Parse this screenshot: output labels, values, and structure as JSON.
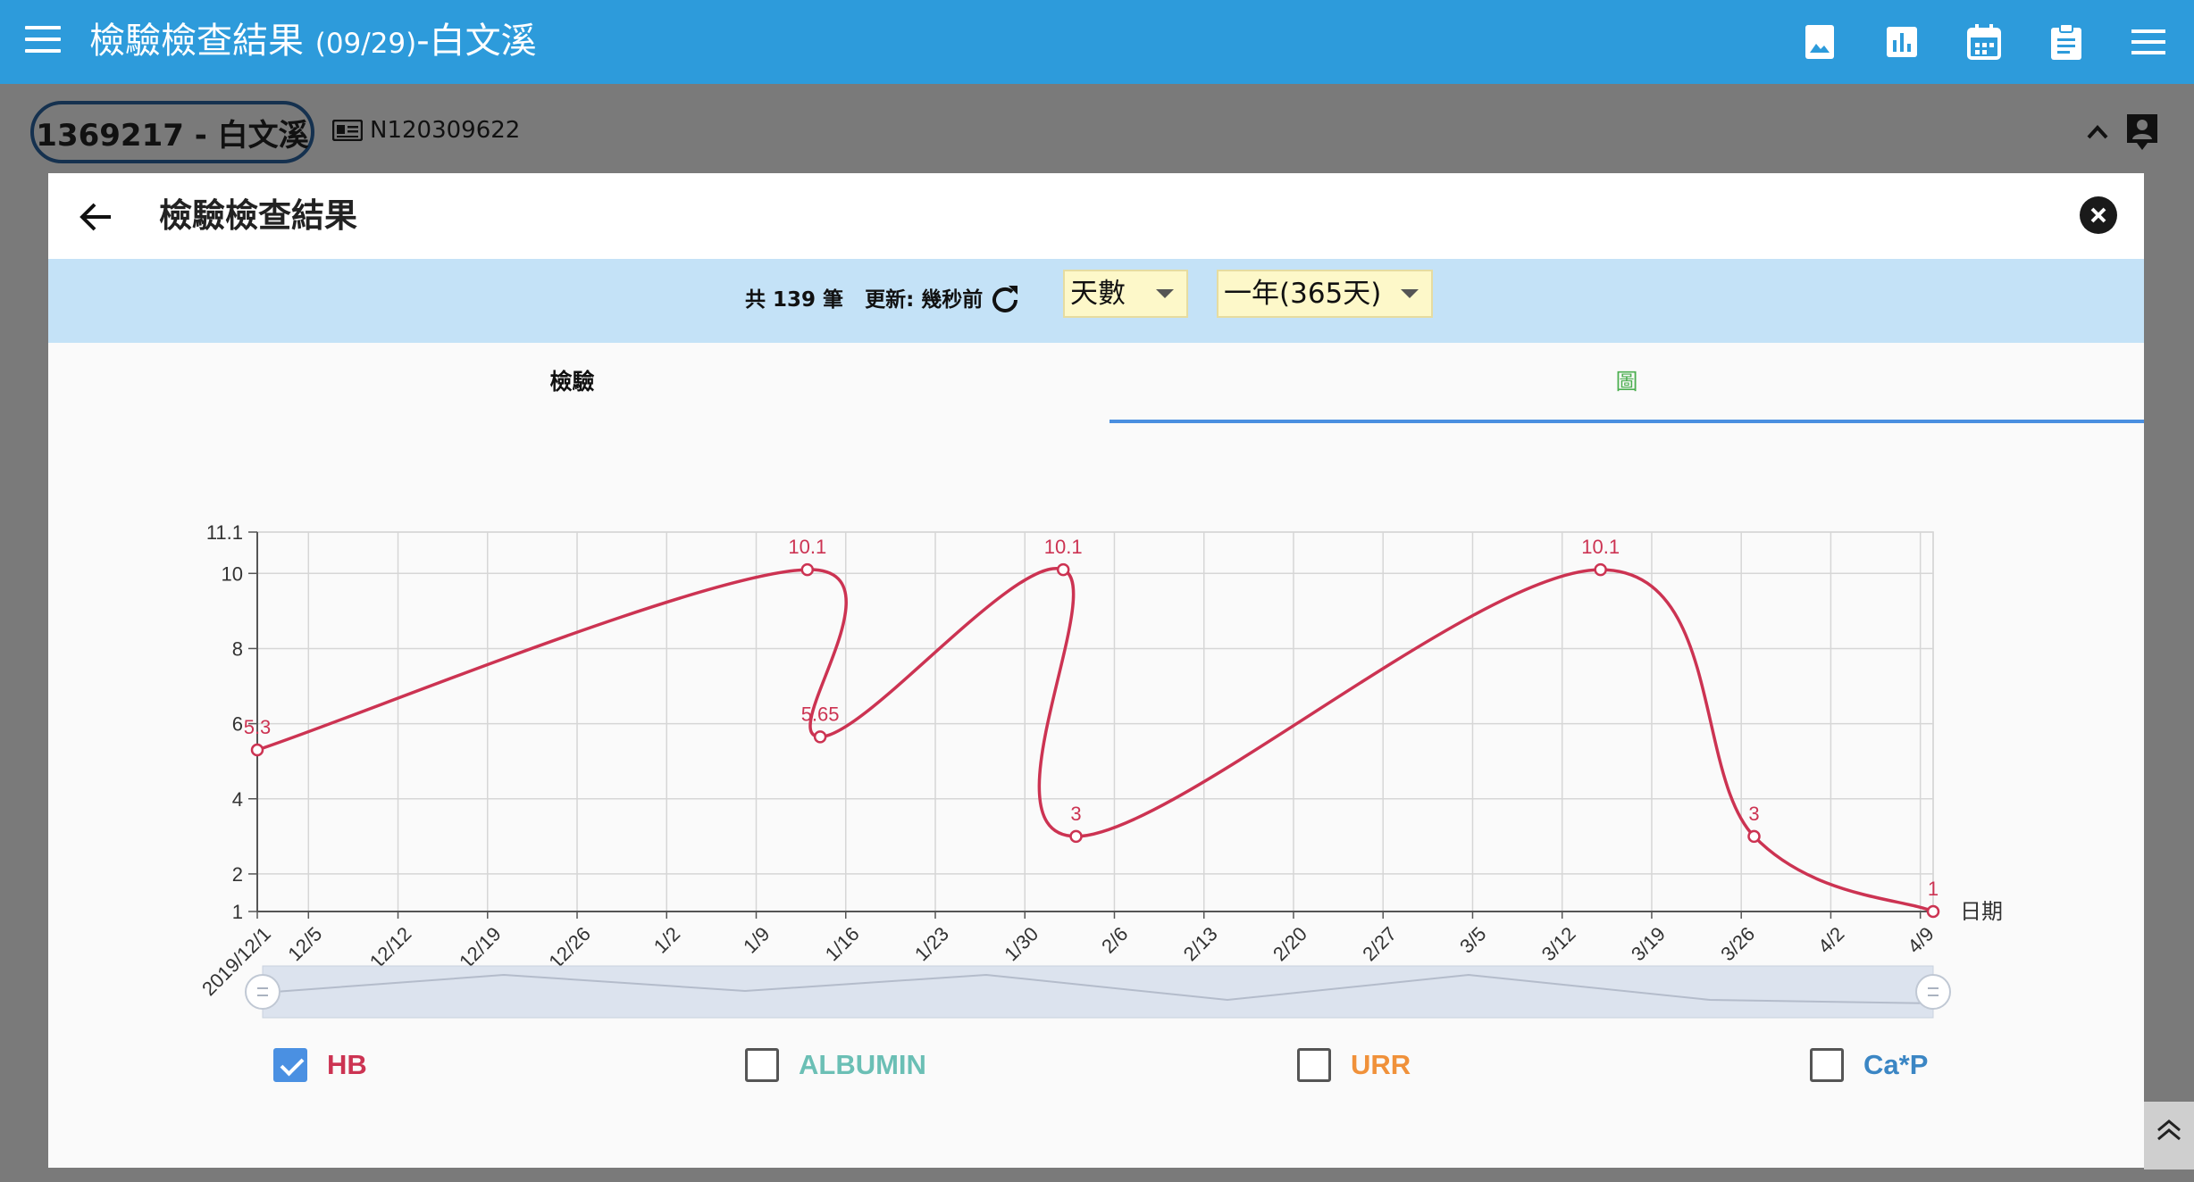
{
  "appbar": {
    "title_prefix": "檢驗檢查結果",
    "title_date": "(09/29)",
    "title_suffix": "-白文溪",
    "color": "#2d9bdb"
  },
  "patient": {
    "pill_text": "1369217 - 白文溪",
    "id_number": "N120309622"
  },
  "modal": {
    "title": "檢驗檢查結果",
    "count_text": "共 139 筆",
    "update_text": "更新: 幾秒前",
    "unit_select": "天數",
    "range_select": "一年(365天)",
    "tabs": [
      {
        "label": "檢驗"
      },
      {
        "label": "圖"
      }
    ]
  },
  "legend": [
    {
      "label": "HB",
      "checked": true,
      "color": "#cc3352"
    },
    {
      "label": "ALBUMIN",
      "checked": false,
      "color": "#6bbfb5"
    },
    {
      "label": "URR",
      "checked": false,
      "color": "#f0913a"
    },
    {
      "label": "Ca*P",
      "checked": false,
      "color": "#3b86c4"
    }
  ],
  "chart_data": {
    "type": "line",
    "x_label": "日期",
    "x_ticks": [
      "2019/12/1",
      "12/5",
      "12/12",
      "12/19",
      "12/26",
      "1/2",
      "1/9",
      "1/16",
      "1/23",
      "1/30",
      "2/6",
      "2/13",
      "2/20",
      "2/27",
      "3/5",
      "3/12",
      "3/19",
      "3/26",
      "4/2",
      "4/9"
    ],
    "y_ticks": [
      1,
      2,
      4,
      6,
      8,
      10,
      11.1
    ],
    "ylim": [
      1,
      11.1
    ],
    "xlim": [
      "2019-12-01",
      "2020-04-10"
    ],
    "grid": true,
    "series": [
      {
        "name": "HB",
        "color": "#cc3352",
        "points": [
          {
            "x": "2019-12-01",
            "y": 5.3,
            "label": "5.3"
          },
          {
            "x": "2020-01-13",
            "y": 10.1,
            "label": "10.1"
          },
          {
            "x": "2020-01-14",
            "y": 5.65,
            "label": "5.65"
          },
          {
            "x": "2020-02-02",
            "y": 10.1,
            "label": "10.1"
          },
          {
            "x": "2020-02-03",
            "y": 3,
            "label": "3"
          },
          {
            "x": "2020-03-15",
            "y": 10.1,
            "label": "10.1"
          },
          {
            "x": "2020-03-27",
            "y": 3,
            "label": "3"
          },
          {
            "x": "2020-04-10",
            "y": 1,
            "label": "1"
          }
        ]
      }
    ]
  }
}
